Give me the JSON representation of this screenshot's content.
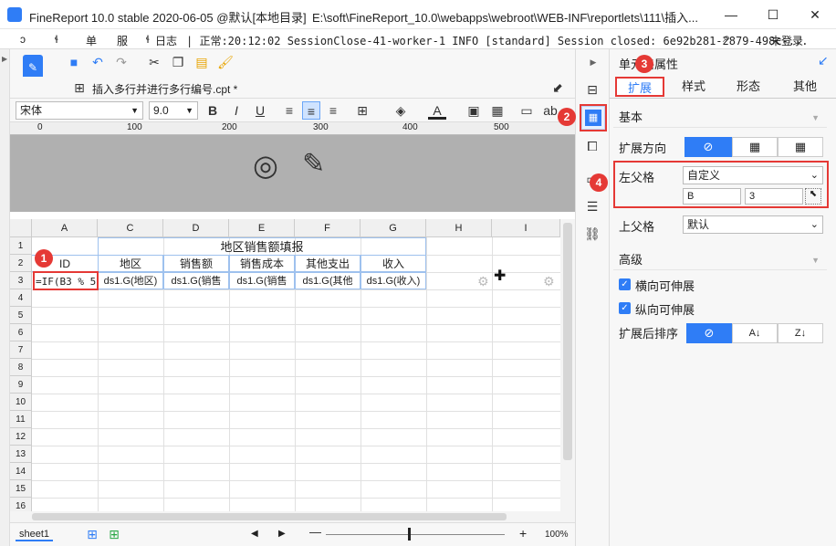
{
  "window": {
    "title": "FineReport 10.0 stable 2020-06-05 @默认[本地目录]",
    "path": "E:\\soft\\FineReport_10.0\\webapps\\webroot\\WEB-INF\\reportlets\\111\\插入...",
    "min": "—",
    "max": "☐",
    "close": "✕"
  },
  "menu": {
    "items": [
      "ɔ",
      "ɬ",
      "单",
      "服",
      "ɬ"
    ],
    "log_label": "日志",
    "log_text": "| 正常:20:12:02 SessionClose-41-worker-1 INFO [standard] Session closed: 6e92b281-2879-498c-...",
    "login": "未登录"
  },
  "tabs": {
    "file_tab": "插入多行并进行多行编号.cpt *"
  },
  "format": {
    "font": "宋体",
    "size": "9.0",
    "bold": "B",
    "italic": "I",
    "underline": "U",
    "text_color": "A",
    "extra": "ab"
  },
  "ruler": {
    "ticks": [
      "0",
      "100",
      "200",
      "300",
      "400",
      "500"
    ]
  },
  "grid": {
    "columns": [
      "A",
      "C",
      "D",
      "E",
      "F",
      "G",
      "H",
      "I"
    ],
    "rows": [
      "1",
      "2",
      "3",
      "4",
      "5",
      "6",
      "7",
      "8",
      "9",
      "10",
      "11",
      "12",
      "13",
      "14",
      "15",
      "16"
    ],
    "title": "地区销售额填报",
    "headers": [
      "ID",
      "地区",
      "销售额",
      "销售成本",
      "其他支出",
      "收入"
    ],
    "row3": [
      "=IF(B3 % 5",
      "ds1.G(地区)",
      "ds1.G(销售",
      "ds1.G(销售",
      "ds1.G(其他",
      "ds1.G(收入)"
    ]
  },
  "bottom": {
    "sheet": "sheet1",
    "zoom": "100%",
    "minus": "—",
    "plus": "+"
  },
  "panel": {
    "title": "单元格属性",
    "tabs": [
      "扩展",
      "样式",
      "形态",
      "其他"
    ],
    "section_basic": "基本",
    "expand_dir_label": "扩展方向",
    "left_parent_label": "左父格",
    "left_parent_value": "自定义",
    "left_parent_col": "B",
    "left_parent_row": "3",
    "up_parent_label": "上父格",
    "up_parent_value": "默认",
    "section_adv": "高级",
    "h_expand": "横向可伸展",
    "v_expand": "纵向可伸展",
    "sort_label": "扩展后排序"
  },
  "badges": [
    "1",
    "2",
    "3",
    "4"
  ],
  "colors": {
    "accent": "#2f7df6",
    "badge": "#e53935"
  }
}
